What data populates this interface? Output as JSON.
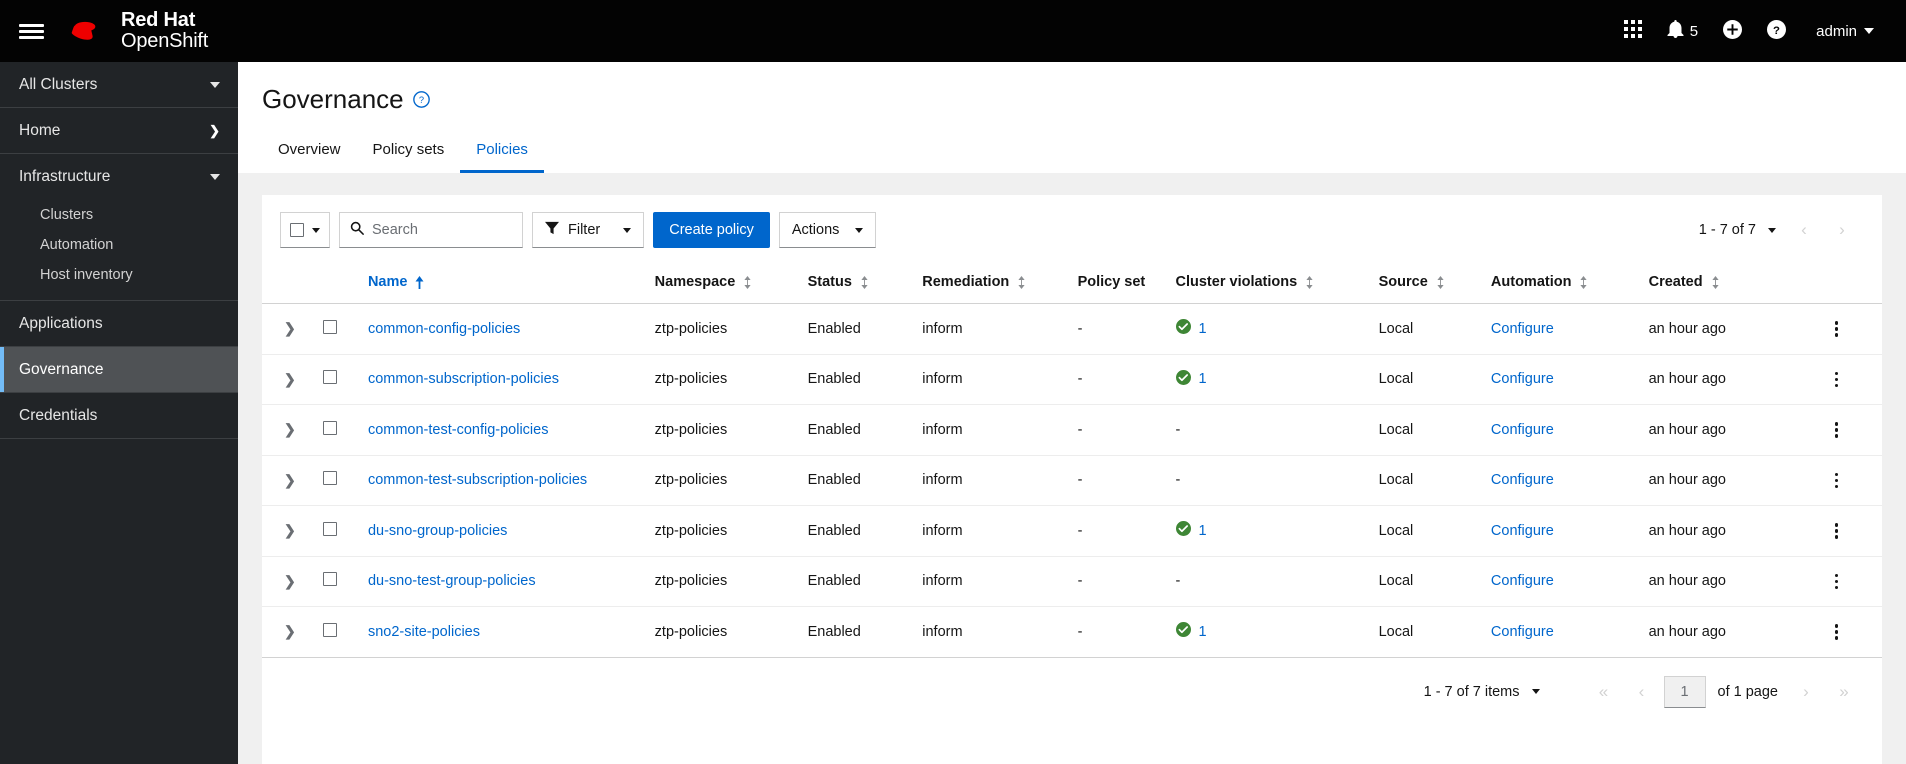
{
  "masthead": {
    "brand_line1": "Red Hat",
    "brand_line2": "OpenShift",
    "menu_icon": "hamburger-icon",
    "app_launcher_icon": "grid-icon",
    "notification_icon": "bell-icon",
    "notification_count": "5",
    "add_icon": "plus-circle-icon",
    "help_icon": "question-circle-icon",
    "user_name": "admin"
  },
  "sidebar": {
    "cluster_selector": "All Clusters",
    "items": [
      {
        "label": "Home",
        "icon": "chevron-right-icon"
      },
      {
        "label": "Infrastructure",
        "icon": "chevron-down-icon"
      },
      {
        "label": "Clusters"
      },
      {
        "label": "Automation"
      },
      {
        "label": "Host inventory"
      },
      {
        "label": "Applications"
      },
      {
        "label": "Governance"
      },
      {
        "label": "Credentials"
      }
    ],
    "active_item": "Governance",
    "accent_color": "#73bcf7"
  },
  "page": {
    "title": "Governance",
    "help_icon": "question-circle-icon",
    "tabs": [
      {
        "label": "Overview",
        "active": false
      },
      {
        "label": "Policy sets",
        "active": false
      },
      {
        "label": "Policies",
        "active": true
      }
    ]
  },
  "toolbar": {
    "bulk_select_icon": "checkbox-icon",
    "search_icon": "search-icon",
    "search_value": "",
    "search_placeholder": "Search",
    "filter_icon": "filter-icon",
    "filter_label": "Filter",
    "create_policy_label": "Create policy",
    "actions_label": "Actions"
  },
  "top_pagination": {
    "summary": "1 - 7 of 7",
    "prev_icon": "chevron-left-icon",
    "next_icon": "chevron-right-icon"
  },
  "table": {
    "columns": [
      {
        "key": "name",
        "label": "Name",
        "sortable": true,
        "sorted": "asc"
      },
      {
        "key": "namespace",
        "label": "Namespace",
        "sortable": true
      },
      {
        "key": "status",
        "label": "Status",
        "sortable": true
      },
      {
        "key": "remediation",
        "label": "Remediation",
        "sortable": true
      },
      {
        "key": "policyset",
        "label": "Policy set",
        "sortable": false
      },
      {
        "key": "violations",
        "label": "Cluster violations",
        "sortable": true
      },
      {
        "key": "source",
        "label": "Source",
        "sortable": true
      },
      {
        "key": "automation",
        "label": "Automation",
        "sortable": true
      },
      {
        "key": "created",
        "label": "Created",
        "sortable": true
      }
    ],
    "rows": [
      {
        "name": "common-config-policies",
        "namespace": "ztp-policies",
        "status": "Enabled",
        "remediation": "inform",
        "policyset": "-",
        "violation_count": "1",
        "violation_status": "ok",
        "source": "Local",
        "automation": "Configure",
        "created": "an hour ago"
      },
      {
        "name": "common-subscription-policies",
        "namespace": "ztp-policies",
        "status": "Enabled",
        "remediation": "inform",
        "policyset": "-",
        "violation_count": "1",
        "violation_status": "ok",
        "source": "Local",
        "automation": "Configure",
        "created": "an hour ago"
      },
      {
        "name": "common-test-config-policies",
        "namespace": "ztp-policies",
        "status": "Enabled",
        "remediation": "inform",
        "policyset": "-",
        "violation_count": "-",
        "violation_status": "none",
        "source": "Local",
        "automation": "Configure",
        "created": "an hour ago"
      },
      {
        "name": "common-test-subscription-policies",
        "namespace": "ztp-policies",
        "status": "Enabled",
        "remediation": "inform",
        "policyset": "-",
        "violation_count": "-",
        "violation_status": "none",
        "source": "Local",
        "automation": "Configure",
        "created": "an hour ago"
      },
      {
        "name": "du-sno-group-policies",
        "namespace": "ztp-policies",
        "status": "Enabled",
        "remediation": "inform",
        "policyset": "-",
        "violation_count": "1",
        "violation_status": "ok",
        "source": "Local",
        "automation": "Configure",
        "created": "an hour ago"
      },
      {
        "name": "du-sno-test-group-policies",
        "namespace": "ztp-policies",
        "status": "Enabled",
        "remediation": "inform",
        "policyset": "-",
        "violation_count": "-",
        "violation_status": "none",
        "source": "Local",
        "automation": "Configure",
        "created": "an hour ago"
      },
      {
        "name": "sno2-site-policies",
        "namespace": "ztp-policies",
        "status": "Enabled",
        "remediation": "inform",
        "policyset": "-",
        "violation_count": "1",
        "violation_status": "ok",
        "source": "Local",
        "automation": "Configure",
        "created": "an hour ago"
      }
    ]
  },
  "bottom_pagination": {
    "summary": "1 - 7 of 7 items",
    "first_icon": "angle-double-left-icon",
    "prev_icon": "chevron-left-icon",
    "page_value": "1",
    "of_page": "of 1 page",
    "next_icon": "chevron-right-icon",
    "last_icon": "angle-double-right-icon"
  },
  "colors": {
    "primary": "#0066cc",
    "link": "#06c",
    "success": "#3e8635",
    "masthead_bg": "#030303",
    "sidebar_bg": "#212427"
  }
}
